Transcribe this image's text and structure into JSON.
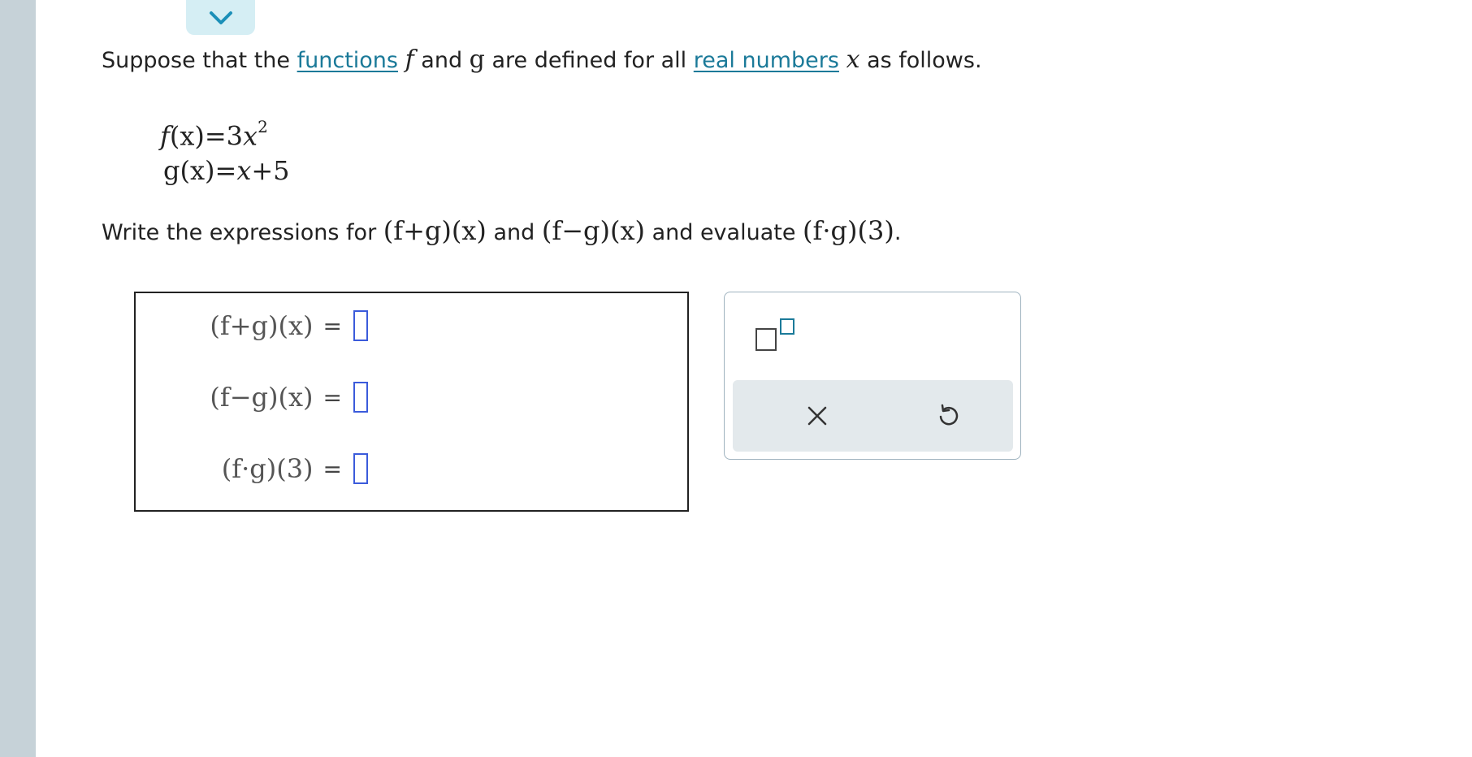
{
  "intro": {
    "part1": "Suppose that the ",
    "functions_link": "functions",
    "f": "f",
    "part2": " and ",
    "g": "g",
    "part3": " are defined for all ",
    "real_numbers_link": "real numbers",
    "x": "x",
    "part4": " as follows."
  },
  "definitions": {
    "f_lhs": "f",
    "f_arg": "(x)",
    "f_rhs": "=3",
    "f_var": "x",
    "f_exp": "2",
    "g_lhs": "g",
    "g_arg": "(x)",
    "g_rhs_eq": "=",
    "g_var": "x",
    "g_rhs_rest": "+5"
  },
  "task": {
    "part1": "Write the expressions for ",
    "expr_sum": "(f+g)(x)",
    "part2": " and ",
    "expr_diff": "(f−g)(x)",
    "part3": " and evaluate ",
    "expr_prod": "(f·g)(3)",
    "part4": "."
  },
  "answers": [
    {
      "label": "(f+g)(x)",
      "equals": "="
    },
    {
      "label": "(f−g)(x)",
      "equals": "="
    },
    {
      "label": "(f·g)(3)",
      "equals": "="
    }
  ],
  "icons": {
    "collapse": "chevron-down-icon",
    "exponent": "exponent-template-icon",
    "clear": "close-icon",
    "undo": "undo-icon"
  },
  "colors": {
    "link": "#1b7a99",
    "slot_border": "#3b5bdb",
    "rail": "#c6d2d8",
    "tab": "#d5eef4",
    "toolbar": "#e3e9ec"
  }
}
